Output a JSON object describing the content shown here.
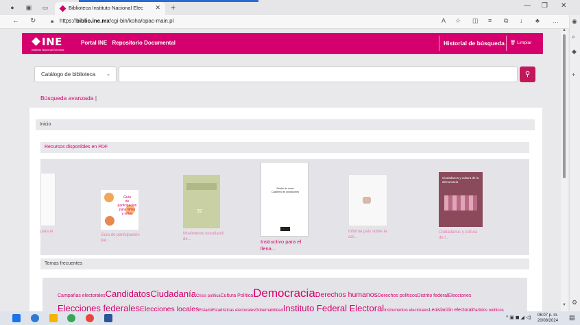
{
  "browser": {
    "tab_title": "Biblioteca Instituto Nacional Elec",
    "url_prefix": "https://",
    "url_host": "biblio.ine.mx",
    "url_path": "/cgi-bin/koha/opac-main.pl",
    "accent_color": "#2a6bd6"
  },
  "header": {
    "logo_text": "INE",
    "logo_sub": "Instituto Nacional Electoral",
    "nav_portal": "Portal INE",
    "nav_repo": "Repositorio Documental",
    "history": "Historial de búsqueda",
    "clear": "Limpiar",
    "brand_color": "#d5006d"
  },
  "search": {
    "scope": "Catálogo de biblioteca",
    "query": "",
    "button_icon": "search-icon"
  },
  "advanced": {
    "label": "Búsqueda avanzada",
    "sep": "|"
  },
  "breadcrumb": "Inicio",
  "pdf_section": "Recursos disponibles en PDF",
  "books": [
    {
      "caption": "para el",
      "cover_lines": []
    },
    {
      "caption": "Guía de participación par...",
      "cover_lines": [
        "Guía",
        "de participación",
        "para niñas",
        "y niños"
      ]
    },
    {
      "caption": "Movimiento estudiantil de...",
      "cover_lines": [
        "32"
      ]
    },
    {
      "caption": "Instructivo para el llena...",
      "cover_lines": [
        "Recibo de actas",
        "Cuaderno de anotaciones"
      ]
    },
    {
      "caption": "Informe país sobre la cal...",
      "cover_lines": []
    },
    {
      "caption": "Ciudadanos y cultura de l...",
      "cover_lines": [
        "Ciudadanos y cultura de la democracia"
      ]
    }
  ],
  "temas_title": "Temas frecuentes",
  "tags_line1": [
    {
      "t": "Campañas electorales",
      "s": "m"
    },
    {
      "t": "Candidatos",
      "s": "xl"
    },
    {
      "t": "Ciudadanía",
      "s": "xl"
    },
    {
      "t": "Crisis política",
      "s": "s"
    },
    {
      "t": "Cultura Política",
      "s": "m"
    },
    {
      "t": "Democracia",
      "s": "xxl"
    },
    {
      "t": "Derechos humanos",
      "s": "l"
    },
    {
      "t": "Derechos políticos",
      "s": "m"
    },
    {
      "t": "Distrito federal",
      "s": "m"
    },
    {
      "t": "Elecciones",
      "s": "m"
    }
  ],
  "tags_line2": [
    {
      "t": "Elecciones federales",
      "s": "xl"
    },
    {
      "t": "Elecciones locales",
      "s": "l"
    },
    {
      "t": "Estado",
      "s": "s"
    },
    {
      "t": "Estadísticas electorales",
      "s": "s"
    },
    {
      "t": "Gobernabilidad",
      "s": "s"
    },
    {
      "t": "Instituto Federal Electoral",
      "s": "xl"
    },
    {
      "t": "Instrumentos electorales",
      "s": "s"
    },
    {
      "t": "Legislación electoral",
      "s": "m"
    },
    {
      "t": "Partidos políticos",
      "s": "s"
    }
  ],
  "taskbar": {
    "time": "06:07 p. m.",
    "date": "20/08/2024"
  }
}
